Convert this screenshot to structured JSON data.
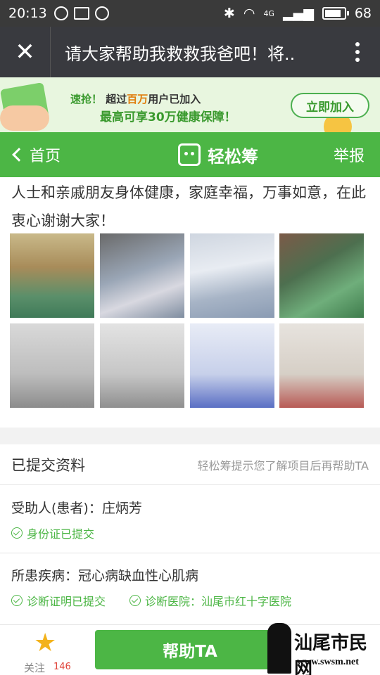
{
  "status_bar": {
    "time": "20:13",
    "battery": "68",
    "network": "4G"
  },
  "title_bar": {
    "title": "请大家帮助我救救我爸吧！将.."
  },
  "banner": {
    "prefix": "速抢！",
    "line1_a": "超过",
    "line1_accent": "百万",
    "line1_b": "用户已加入",
    "line2": "最高可享30万健康保障！",
    "button": "立即加入"
  },
  "nav": {
    "back": "首页",
    "brand": "轻松筹",
    "report": "举报"
  },
  "story": {
    "text": "人士和亲戚朋友身体健康，家庭幸福，万事如意，在此衷心谢谢大家！"
  },
  "info": {
    "title": "已提交资料",
    "hint": "轻松筹提示您了解项目后再帮助TA",
    "patient": "受助人(患者)：庄炳芳",
    "id_check": "身份证已提交",
    "disease": "所患疾病：冠心病缺血性心肌病",
    "diag_check": "诊断证明已提交",
    "hospital_check": "诊断医院：汕尾市红十字医院"
  },
  "bottom": {
    "follow_label": "关注",
    "follow_count": "146",
    "help_button": "帮助TA"
  },
  "watermark": {
    "text": "汕尾市民网",
    "url": "www.swsm.net"
  }
}
